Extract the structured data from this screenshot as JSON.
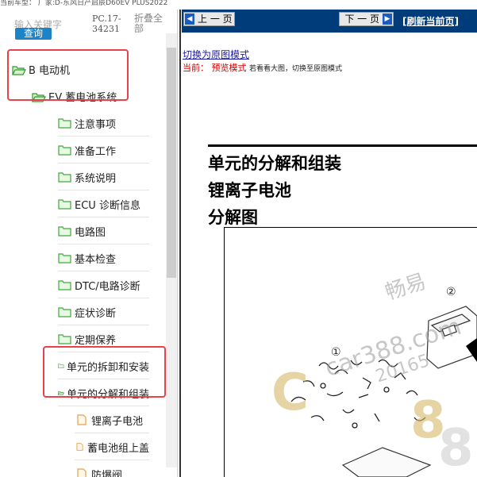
{
  "window": {
    "vehicle_line": "当前车型：  厂家:D-东风日产启辰D60EV PLUS2022"
  },
  "search": {
    "placeholder": "输入关键字",
    "query_button": "查询",
    "model_code": "PC.17-34231",
    "collapse_all": "折叠全部"
  },
  "tree": {
    "items": [
      {
        "label": "B 电动机",
        "level": 0,
        "icon": "folder-open-icon"
      },
      {
        "label": "EV 蓄电池系统",
        "level": 1,
        "icon": "folder-open-icon"
      },
      {
        "label": "注意事项",
        "level": 2,
        "icon": "folder-icon"
      },
      {
        "label": "准备工作",
        "level": 2,
        "icon": "folder-icon"
      },
      {
        "label": "系统说明",
        "level": 2,
        "icon": "folder-icon"
      },
      {
        "label": "ECU 诊断信息",
        "level": 2,
        "icon": "folder-icon"
      },
      {
        "label": "电路图",
        "level": 2,
        "icon": "folder-icon"
      },
      {
        "label": "基本检查",
        "level": 2,
        "icon": "folder-icon"
      },
      {
        "label": "DTC/电路诊断",
        "level": 2,
        "icon": "folder-icon"
      },
      {
        "label": "症状诊断",
        "level": 2,
        "icon": "folder-icon"
      },
      {
        "label": "定期保养",
        "level": 2,
        "icon": "folder-icon"
      },
      {
        "label": "单元的拆卸和安装",
        "level": 2,
        "icon": "folder-icon"
      },
      {
        "label": "单元的分解和组装",
        "level": 2,
        "icon": "folder-open-icon"
      },
      {
        "label": "锂离子电池",
        "level": 3,
        "icon": "document-icon"
      },
      {
        "label": "蓄电池组上盖",
        "level": 3,
        "icon": "document-icon"
      },
      {
        "label": "防爆阀",
        "level": 3,
        "icon": "document-icon"
      }
    ]
  },
  "nav": {
    "prev_label": "上 一 页",
    "next_label": "下 一 页",
    "refresh_label": "[刷新当前页]"
  },
  "viewer": {
    "switch_link": "切换为原图模式",
    "mode_prefix": "当前：",
    "mode_name": "预览模式",
    "mode_hint": "若看看大图，切换至原图模式"
  },
  "doc": {
    "title_line1": "单元的分解和组装",
    "title_line2": "锂离子电池",
    "title_line3": "分解图",
    "callouts": [
      "①",
      "②"
    ],
    "watermark_cn": "畅易",
    "watermark_url": "car388.com",
    "watermark_fragment": "20165"
  },
  "colors": {
    "navbar": "#003c7a",
    "accent": "#1c84c6",
    "highlight_box": "#e8424d",
    "folder": "#3daa3d"
  }
}
